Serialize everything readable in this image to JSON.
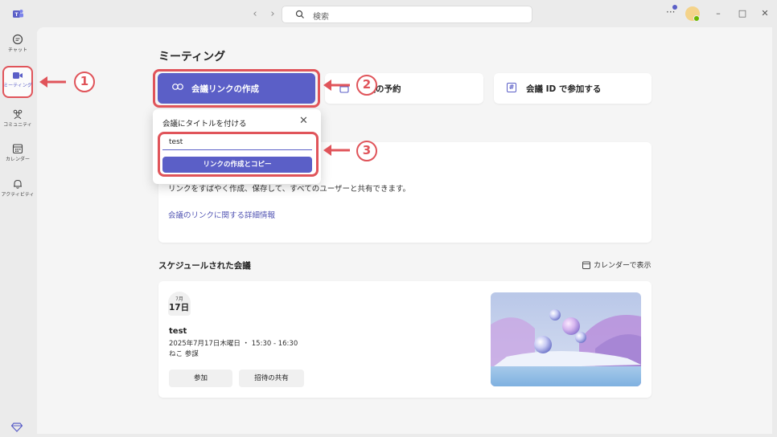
{
  "titlebar": {
    "search_placeholder": "検索",
    "nav_back": "‹",
    "nav_forward": "›",
    "more": "···",
    "minimize": "–",
    "maximize": "□",
    "close": "✕"
  },
  "rail": {
    "items": [
      {
        "label": "チャット",
        "icon": "chat-icon"
      },
      {
        "label": "ミーティング",
        "icon": "video-icon",
        "active": true
      },
      {
        "label": "コミュニティ",
        "icon": "community-icon"
      },
      {
        "label": "カレンダー",
        "icon": "calendar-icon"
      },
      {
        "label": "アクティビティ",
        "icon": "bell-icon"
      }
    ]
  },
  "page": {
    "title": "ミーティング"
  },
  "actions": {
    "create_link": "会議リンクの作成",
    "schedule": "会議の予約",
    "join_by_id": "会議 ID で参加する"
  },
  "popover": {
    "title": "会議にタイトルを付ける",
    "input_value": "test",
    "submit": "リンクの作成とコピー",
    "close": "✕"
  },
  "info": {
    "description": "リンクをすばやく作成、保存して、すべてのユーザーと共有できます。",
    "link": "会議のリンクに関する詳細情報"
  },
  "annotations": {
    "one": "1",
    "two": "2",
    "three": "3",
    "color": "#e0545a"
  },
  "scheduled": {
    "title": "スケジュールされた会議",
    "calendar_view": "カレンダーで表示",
    "meeting": {
      "month": "7月",
      "day": "17日",
      "title": "test",
      "time": "2025年7月17日木曜日 ・ 15:30 - 16:30",
      "organizer": "ねこ 参謀",
      "join": "参加",
      "share": "招待の共有"
    }
  },
  "colors": {
    "accent": "#5b5fc7",
    "annotation": "#e0545a"
  }
}
